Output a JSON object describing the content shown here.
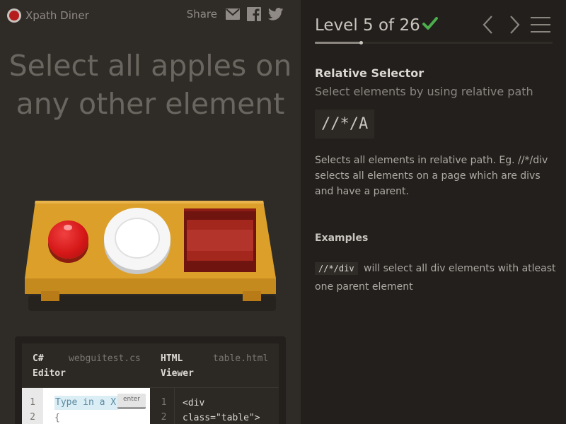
{
  "app": {
    "name": "Xpath Diner"
  },
  "share": {
    "label": "Share",
    "icons": [
      "mail-icon",
      "facebook-icon",
      "twitter-icon"
    ]
  },
  "game": {
    "instruction": "Select all apples on any other element",
    "table_items": [
      "apple",
      "plate",
      "bento"
    ]
  },
  "editor": {
    "css_pane_title": "C# Editor",
    "css_pane_file": "webguitest.cs",
    "html_pane_title": "HTML Viewer",
    "html_pane_file": "table.html",
    "css_line_numbers": [
      "1",
      "2"
    ],
    "html_line_numbers": [
      "1",
      "2"
    ],
    "input_placeholder": "Type in a XPath selector",
    "input_value": "Type in a X",
    "brace": "{",
    "enter_label": "enter",
    "html_lines": [
      "<div",
      "class=\"table\">"
    ]
  },
  "level": {
    "label": "Level 5 of 26",
    "current": 5,
    "total": 26,
    "completed": true,
    "progress": 0.1923
  },
  "selector": {
    "name": "Relative Selector",
    "title": "Select elements by using relative path",
    "syntax": "//*/A",
    "description": "Selects all elements in relative path. Eg. //*/div selects all elements on a page which are divs and have a parent.",
    "examples_title": "Examples",
    "example_code": "//*/div",
    "example_text": "will select all div elements with atleast one parent element"
  },
  "colors": {
    "accent_green": "#4cae4c",
    "apple_red": "#d61818",
    "table_wood": "#dca02a",
    "bento_red": "#7a1712"
  }
}
